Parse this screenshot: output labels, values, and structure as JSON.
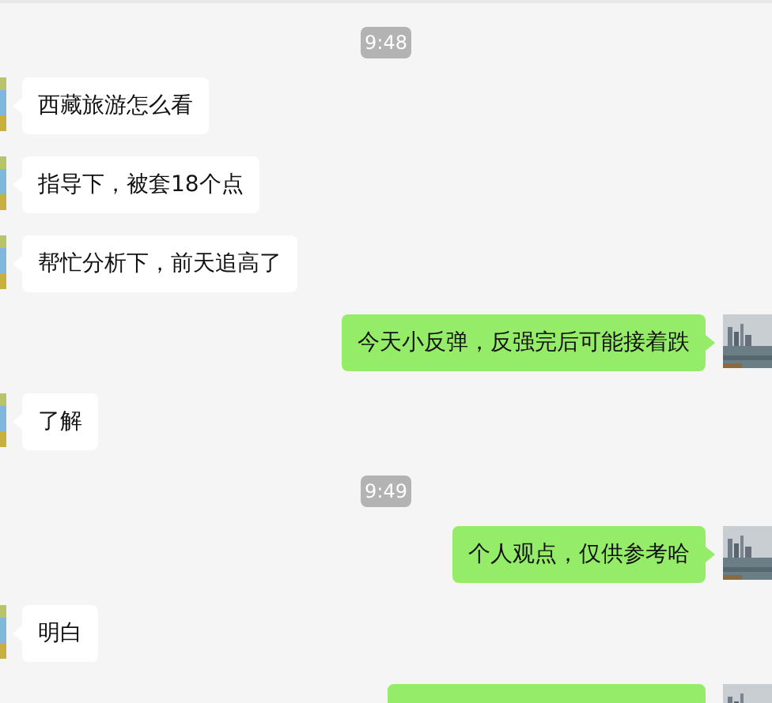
{
  "messages": [
    {
      "kind": "time",
      "text": "9:48"
    },
    {
      "kind": "incoming",
      "text": "西藏旅游怎么看"
    },
    {
      "kind": "incoming",
      "text": "指导下，被套18个点"
    },
    {
      "kind": "incoming",
      "text": "帮忙分析下，前天追高了"
    },
    {
      "kind": "outgoing",
      "text": "今天小反弹，反强完后可能接着跌"
    },
    {
      "kind": "incoming",
      "text": "了解"
    },
    {
      "kind": "time",
      "text": "9:49"
    },
    {
      "kind": "outgoing",
      "text": "个人观点，仅供参考哈"
    },
    {
      "kind": "incoming",
      "text": "明白"
    },
    {
      "kind": "outgoing"
    }
  ]
}
